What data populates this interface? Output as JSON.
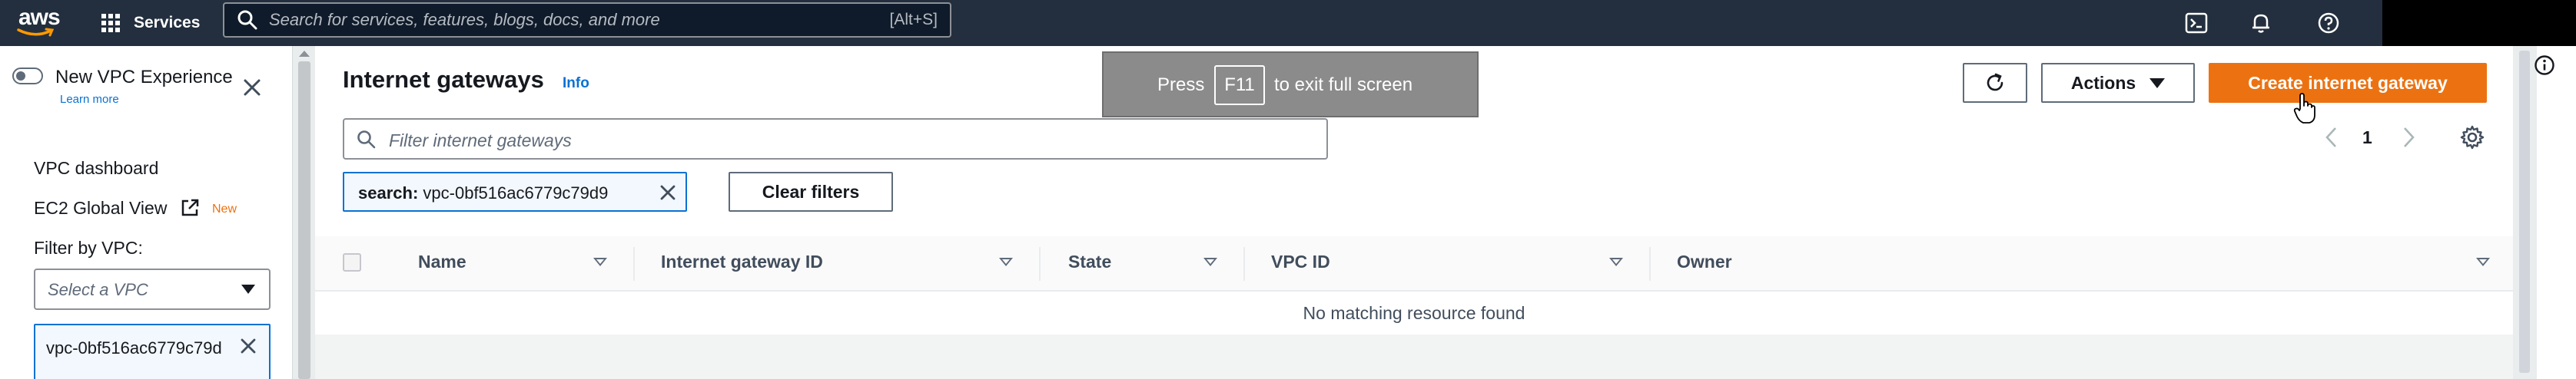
{
  "topnav": {
    "logo_text": "aws",
    "services_label": "Services",
    "search_placeholder": "Search for services, features, blogs, docs, and more",
    "search_shortcut": "[Alt+S]"
  },
  "sidebar": {
    "toggle_label": "New VPC Experience",
    "learn_more": "Learn more",
    "items": [
      {
        "label": "VPC dashboard"
      },
      {
        "label": "EC2 Global View",
        "badge": "New"
      }
    ],
    "filter_label": "Filter by VPC:",
    "select_placeholder": "Select a VPC",
    "selected_vpc": "vpc-0bf516ac6779c79d"
  },
  "header": {
    "title": "Internet gateways",
    "info": "Info",
    "actions_label": "Actions",
    "create_label": "Create internet gateway"
  },
  "fullscreen_banner": {
    "press": "Press",
    "key": "F11",
    "rest": "to exit full screen"
  },
  "filter": {
    "placeholder": "Filter internet gateways",
    "token_key": "search:",
    "token_value": "vpc-0bf516ac6779c79d9",
    "clear_label": "Clear filters"
  },
  "pagination": {
    "current_page": "1"
  },
  "table": {
    "columns": [
      "Name",
      "Internet gateway ID",
      "State",
      "VPC ID",
      "Owner"
    ],
    "empty_message": "No matching resource found"
  },
  "colors": {
    "nav_bg": "#232f3e",
    "primary_orange": "#ec7211",
    "link_blue": "#0972d3"
  },
  "icons": [
    "grid-icon",
    "search-icon",
    "terminal-icon",
    "bell-icon",
    "help-icon",
    "close-icon",
    "external-link-icon",
    "refresh-icon",
    "chevron-left-icon",
    "chevron-right-icon",
    "gear-icon",
    "info-icon",
    "hand-cursor-icon"
  ]
}
